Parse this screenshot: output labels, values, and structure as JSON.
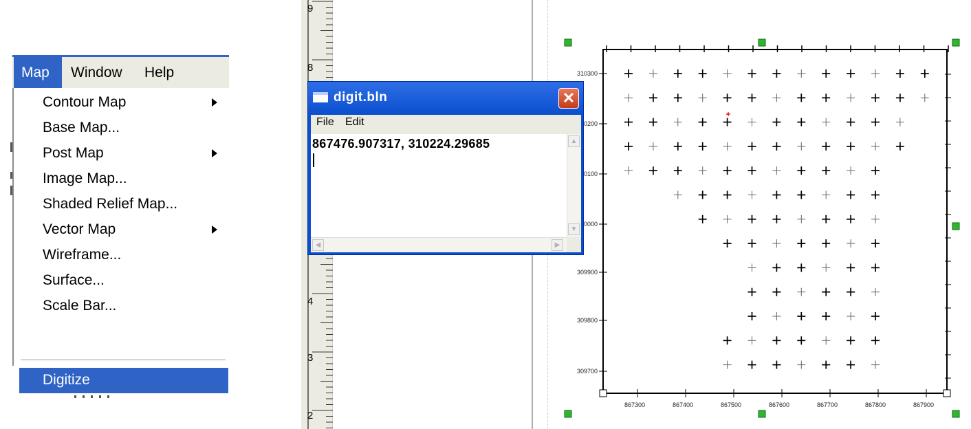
{
  "menubar": {
    "items": [
      {
        "label": "Map",
        "active": true
      },
      {
        "label": "Window",
        "active": false
      },
      {
        "label": "Help",
        "active": false
      }
    ]
  },
  "map_menu": {
    "items": [
      {
        "label": "Contour Map",
        "submenu": true
      },
      {
        "label": "Base Map...",
        "submenu": false
      },
      {
        "label": "Post Map",
        "submenu": true
      },
      {
        "label": "Image Map...",
        "submenu": false
      },
      {
        "label": "Shaded Relief Map...",
        "submenu": false
      },
      {
        "label": "Vector Map",
        "submenu": true
      },
      {
        "label": "Wireframe...",
        "submenu": false
      },
      {
        "label": "Surface...",
        "submenu": false
      },
      {
        "label": "Scale Bar...",
        "submenu": false
      }
    ],
    "selected": "Digitize"
  },
  "ruler": {
    "labels": [
      "9",
      "8",
      "4",
      "3",
      "2"
    ]
  },
  "dialog": {
    "title": "digit.bln",
    "close_glyph": "✕",
    "menu": [
      "File",
      "Edit"
    ],
    "content": "867476.907317, 310224.29685"
  },
  "plot": {
    "x_tick_labels": [
      "867300",
      "867400",
      "867500",
      "867600",
      "867700",
      "867800",
      "867900"
    ],
    "y_tick_labels": [
      "310300",
      "310200",
      "310100",
      "310000",
      "309900",
      "309800",
      "309700"
    ],
    "colors": {
      "handle": "#2fb52f",
      "cursor": "#e02020",
      "marker": "#000000"
    }
  }
}
